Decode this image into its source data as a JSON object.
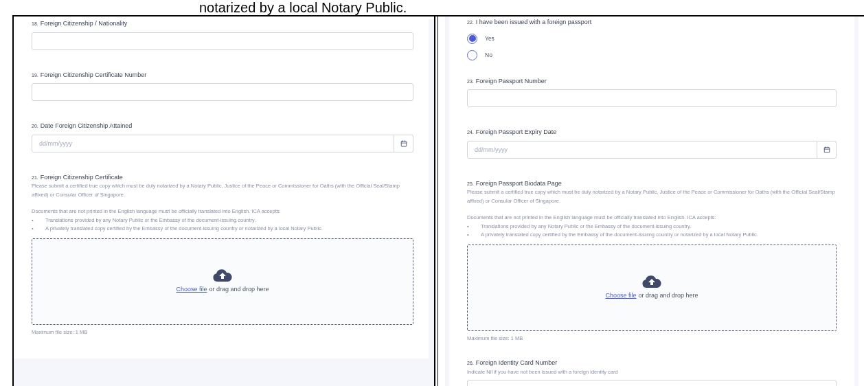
{
  "document_text": "notarized by a local Notary Public.",
  "panels": [
    {
      "fields": [
        {
          "kind": "text",
          "number": "18.",
          "label": "Foreign Citizenship / Nationality"
        },
        {
          "kind": "text",
          "number": "19.",
          "label": "Foreign Citizenship Certificate Number"
        },
        {
          "kind": "date",
          "number": "20.",
          "label": "Date Foreign Citizenship Attained",
          "placeholder": "dd/mm/yyyy"
        },
        {
          "kind": "upload",
          "number": "21.",
          "label": "Foreign Citizenship Certificate",
          "paragraphs": [
            "Please submit a certified true copy which must be duly notarized by a Notary Public, Justice of the Peace or Commissioner for Oaths (with the Official Seal/Stamp affixed) or Consular Officer of Singapore.",
            "Documents that are not printed in the English language must be officially translated into English. ICA accepts:"
          ],
          "bullets": [
            {
              "marker": "•",
              "text": "Translations provided by any Notary Public or the Embassy of the document-issuing country."
            },
            {
              "marker": "•",
              "text": "A privately translated copy certified by the Embassy of the document-issuing country or notarized by a local Notary Public."
            }
          ],
          "link": "Choose file",
          "drop_text": "or drag and drop here",
          "size_note": "Maximum file size: 1 MB"
        }
      ]
    },
    {
      "fields": [
        {
          "kind": "radio",
          "number": "22.",
          "label": "I have been issued with a foreign passport",
          "options": [
            {
              "label": "Yes",
              "selected": true
            },
            {
              "label": "No",
              "selected": false
            }
          ]
        },
        {
          "kind": "text",
          "number": "23.",
          "label": "Foreign Passport Number"
        },
        {
          "kind": "date",
          "number": "24.",
          "label": "Foreign Passport Expiry Date",
          "placeholder": "dd/mm/yyyy"
        },
        {
          "kind": "upload",
          "number": "25.",
          "label": "Foreign Passport Biodata Page",
          "paragraphs": [
            "Please submit a certified true copy which must be duly notarized by a Notary Public, Justice of the Peace or Commissioner for Oaths (with the Official Seal/Stamp affixed) or Consular Officer of Singapore.",
            "Documents that are not printed in the English language must be officially translated into English. ICA accepts:"
          ],
          "bullets": [
            {
              "marker": "•",
              "text": "Translations provided by any Notary Public or the Embassy of the document-issuing country."
            },
            {
              "marker": "•",
              "text": "A privately translated copy certified by the Embassy of the document-issuing country or notarized by a local Notary Public."
            }
          ],
          "link": "Choose file",
          "drop_text": "or drag and drop here",
          "size_note": "Maximum file size: 1 MB"
        },
        {
          "kind": "text",
          "number": "26.",
          "label": "Foreign Identity Card Number",
          "hint": "Indicate Nil if you have not been issued with a foreign identity card"
        }
      ]
    }
  ]
}
